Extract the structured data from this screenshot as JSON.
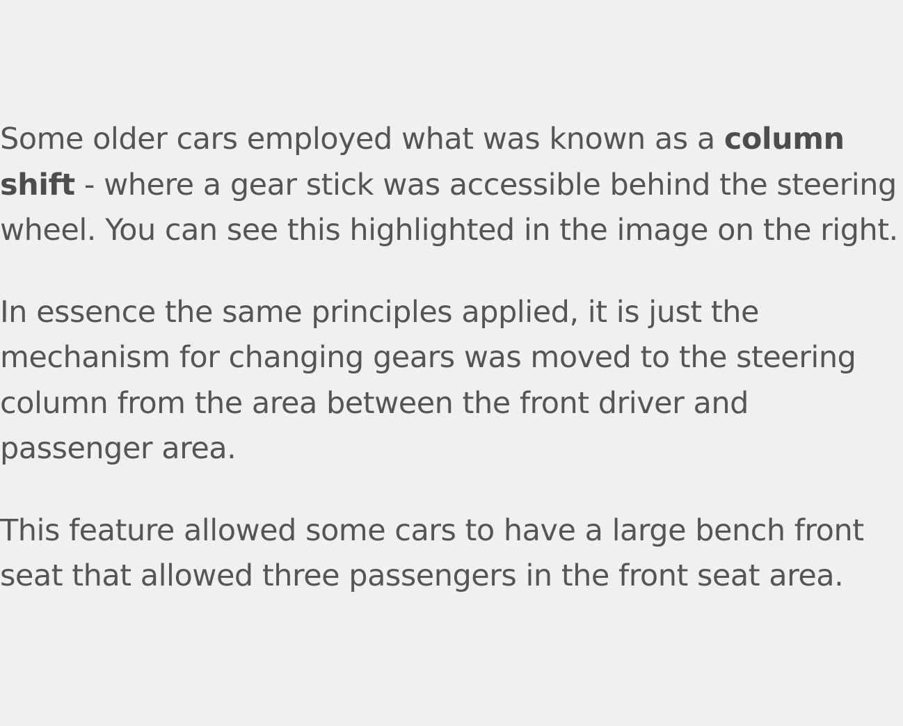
{
  "paragraphs": [
    {
      "before": "Some older cars employed what was known as a ",
      "bold": "column shift",
      "after": " - where a gear stick was accessible behind the steering wheel. You can see this highlighted in the image on the right."
    },
    {
      "text": "In essence the same principles applied, it is just the mechanism for changing gears was moved to the steering column from the area between the front driver and passenger area."
    },
    {
      "text": "This feature allowed some cars to have a large bench front seat that allowed three passengers in the front seat area."
    }
  ],
  "colors": {
    "background": "#f0f0f0",
    "text": "#555555"
  }
}
